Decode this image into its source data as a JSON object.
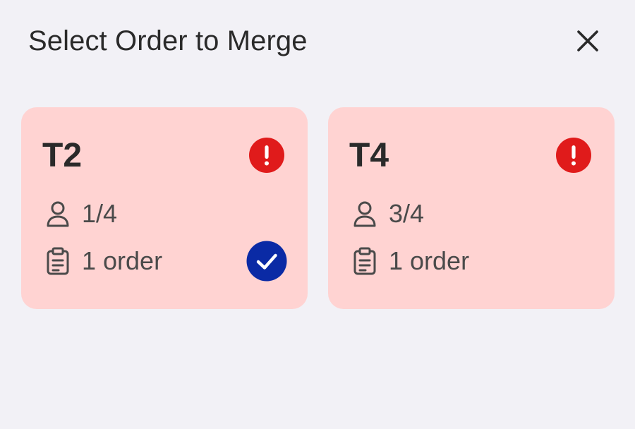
{
  "header": {
    "title": "Select Order to Merge",
    "close_icon": "close-icon"
  },
  "colors": {
    "background": "#f2f1f6",
    "card_background": "#ffd3d2",
    "alert": "#e01b1b",
    "selected_check": "#0a2aa5",
    "text_primary": "#2a2a2a",
    "text_secondary": "#4a4a4a"
  },
  "tables": [
    {
      "name": "T2",
      "guests": "1/4",
      "orders": "1 order",
      "alert_icon": "exclamation-circle-icon",
      "selected": true
    },
    {
      "name": "T4",
      "guests": "3/4",
      "orders": "1 order",
      "alert_icon": "exclamation-circle-icon",
      "selected": false
    }
  ]
}
